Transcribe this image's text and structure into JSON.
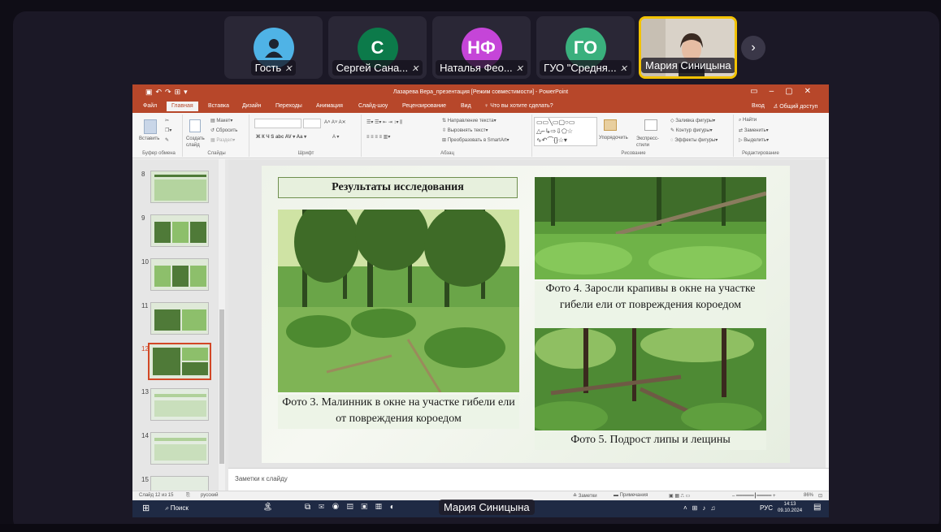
{
  "participants": [
    {
      "name": "Гость",
      "initials": "",
      "color": "#4fb3e6"
    },
    {
      "name": "Сергей Сана...",
      "initials": "С",
      "color": "#0c7a4a"
    },
    {
      "name": "Наталья Фео...",
      "initials": "НФ",
      "color": "#c545d8"
    },
    {
      "name": "ГУО \"Средня...",
      "initials": "ГО",
      "color": "#3ab07d"
    },
    {
      "name": "Мария Синицына",
      "initials": "",
      "color": "#000000"
    }
  ],
  "presenter_overlay": "Мария Синицына",
  "app": {
    "window_title": "Лазарева Вера_презентация [Режим совместимости] - PowerPoint",
    "menu": [
      "Файл",
      "Главная",
      "Вставка",
      "Дизайн",
      "Переходы",
      "Анимация",
      "Слайд-шоу",
      "Рецензирование",
      "Вид"
    ],
    "tell_me": "Что вы хотите сделать?",
    "signin": "Вход",
    "share": "Общий доступ",
    "ribbon": {
      "paste": "Вставить",
      "new_slide": "Создать слайд",
      "layout": "Макет",
      "reset": "Сбросить",
      "section": "Раздел",
      "text_direction": "Направление текста",
      "align_text": "Выровнять текст",
      "smartart": "Преобразовать в SmartArt",
      "arrange": "Упорядочить",
      "quick_styles": "Экспресс-стили",
      "shape_fill": "Заливка фигуры",
      "shape_outline": "Контур фигуры",
      "shape_effects": "Эффекты фигуры",
      "find": "Найти",
      "replace": "Заменить",
      "select": "Выделить",
      "groups": [
        "Буфер обмена",
        "Слайды",
        "Шрифт",
        "Абзац",
        "Рисование",
        "Редактирование"
      ]
    },
    "slide_numbers": [
      "8",
      "9",
      "10",
      "11",
      "12",
      "13",
      "14",
      "15"
    ],
    "notes_placeholder": "Заметки к слайду",
    "status": {
      "slide_of": "Слайд 12 из 15",
      "language": "русский",
      "notes": "Заметки",
      "comments": "Примечания",
      "zoom": "86%"
    }
  },
  "slide": {
    "title": "Результаты исследования",
    "captions": [
      "Фото 3. Малинник в окне на участке гибели ели от повреждения короедом",
      "Фото 4. Заросли крапивы в окне на участке гибели ели от повреждения короедом",
      "Фото 5. Подрост липы и лещины"
    ]
  },
  "taskbar": {
    "search": "Поиск",
    "lang": "РУС",
    "time": "14:13",
    "date": "09.10.2024"
  }
}
